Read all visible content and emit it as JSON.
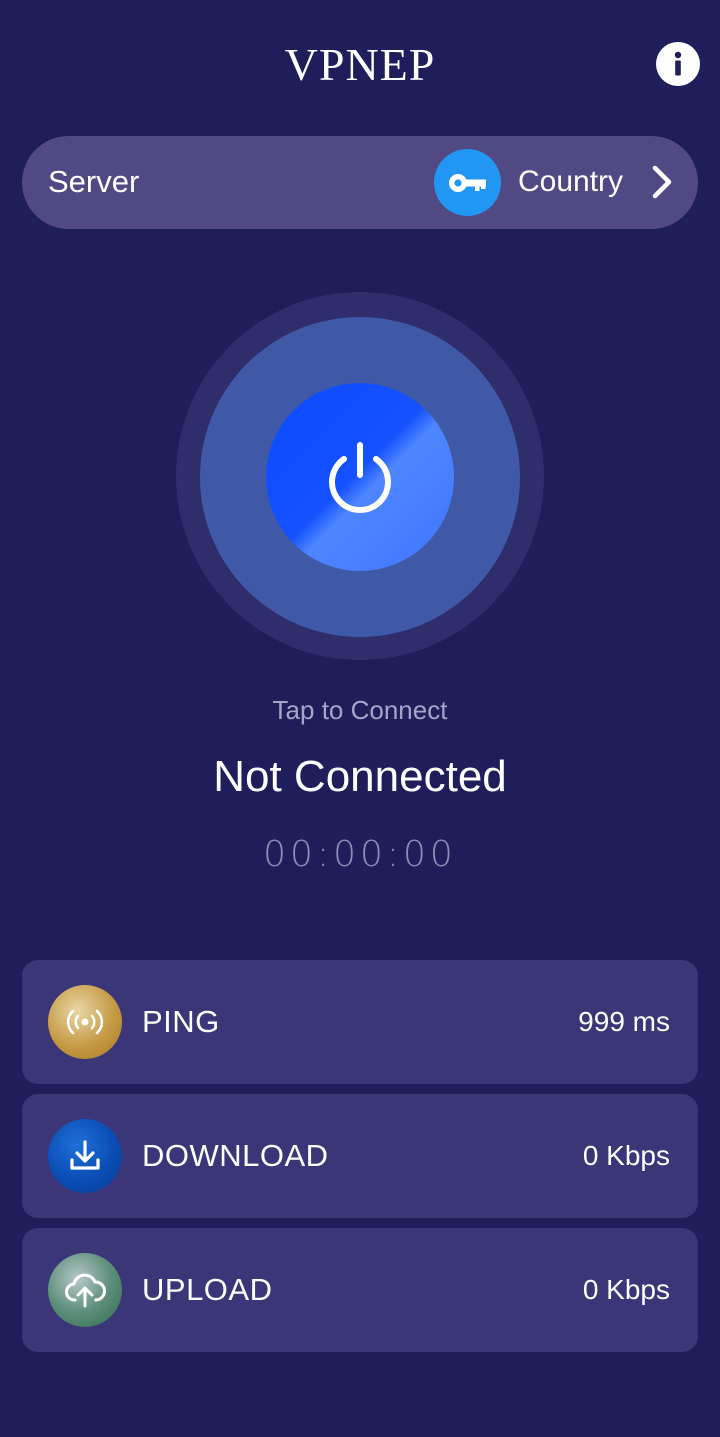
{
  "app": {
    "title": "VPNEP"
  },
  "header": {
    "info_icon": "info-icon"
  },
  "server": {
    "label": "Server",
    "key_icon": "key-icon",
    "country_label": "Country",
    "chevron_icon": "chevron-right-icon"
  },
  "connection": {
    "power_icon": "power-icon",
    "hint": "Tap to Connect",
    "status": "Not Connected",
    "timer": "00:00:00"
  },
  "stats": [
    {
      "label": "PING",
      "value": "999 ms",
      "icon": "ping-signal-icon"
    },
    {
      "label": "DOWNLOAD",
      "value": "0 Kbps",
      "icon": "download-icon"
    },
    {
      "label": "UPLOAD",
      "value": "0 Kbps",
      "icon": "upload-cloud-icon"
    }
  ],
  "colors": {
    "background": "#201d5b",
    "server_bar": "#504983",
    "card": "#3b3677",
    "key_badge": "#2196f3",
    "power_button": "#1550ff",
    "power_ring": "#3f59a7"
  }
}
